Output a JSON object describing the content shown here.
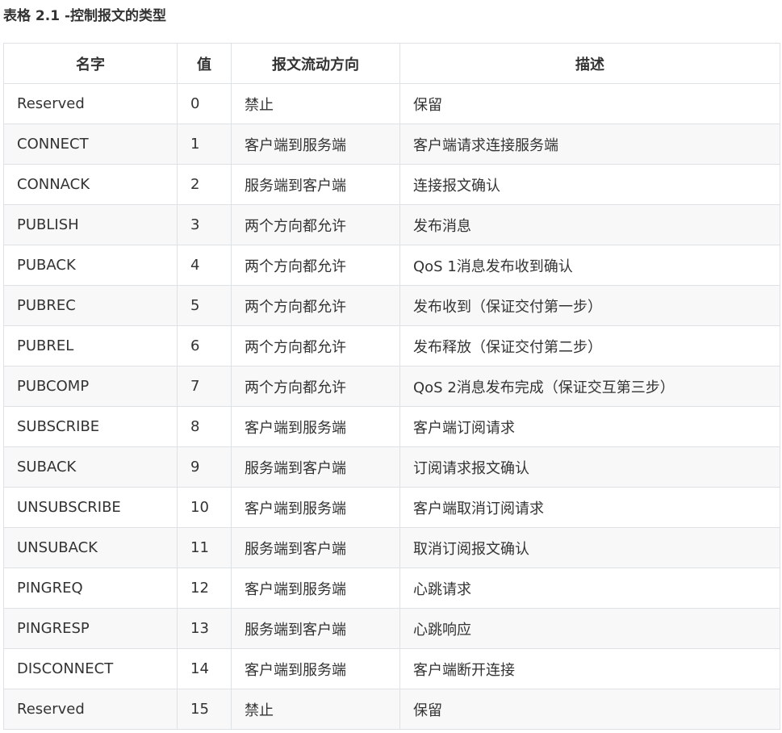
{
  "caption": "表格 2.1 -控制报文的类型",
  "headers": {
    "name": "名字",
    "value": "值",
    "direction": "报文流动方向",
    "description": "描述"
  },
  "rows": [
    {
      "name": "Reserved",
      "value": "0",
      "direction": "禁止",
      "description": "保留"
    },
    {
      "name": "CONNECT",
      "value": "1",
      "direction": "客户端到服务端",
      "description": "客户端请求连接服务端"
    },
    {
      "name": "CONNACK",
      "value": "2",
      "direction": "服务端到客户端",
      "description": "连接报文确认"
    },
    {
      "name": "PUBLISH",
      "value": "3",
      "direction": "两个方向都允许",
      "description": "发布消息"
    },
    {
      "name": "PUBACK",
      "value": "4",
      "direction": "两个方向都允许",
      "description": "QoS 1消息发布收到确认"
    },
    {
      "name": "PUBREC",
      "value": "5",
      "direction": "两个方向都允许",
      "description": "发布收到（保证交付第一步）"
    },
    {
      "name": "PUBREL",
      "value": "6",
      "direction": "两个方向都允许",
      "description": "发布释放（保证交付第二步）"
    },
    {
      "name": "PUBCOMP",
      "value": "7",
      "direction": "两个方向都允许",
      "description": "QoS 2消息发布完成（保证交互第三步）"
    },
    {
      "name": "SUBSCRIBE",
      "value": "8",
      "direction": "客户端到服务端",
      "description": "客户端订阅请求"
    },
    {
      "name": "SUBACK",
      "value": "9",
      "direction": "服务端到客户端",
      "description": "订阅请求报文确认"
    },
    {
      "name": "UNSUBSCRIBE",
      "value": "10",
      "direction": "客户端到服务端",
      "description": "客户端取消订阅请求"
    },
    {
      "name": "UNSUBACK",
      "value": "11",
      "direction": "服务端到客户端",
      "description": "取消订阅报文确认"
    },
    {
      "name": "PINGREQ",
      "value": "12",
      "direction": "客户端到服务端",
      "description": "心跳请求"
    },
    {
      "name": "PINGRESP",
      "value": "13",
      "direction": "服务端到客户端",
      "description": "心跳响应"
    },
    {
      "name": "DISCONNECT",
      "value": "14",
      "direction": "客户端到服务端",
      "description": "客户端断开连接"
    },
    {
      "name": "Reserved",
      "value": "15",
      "direction": "禁止",
      "description": "保留"
    }
  ]
}
